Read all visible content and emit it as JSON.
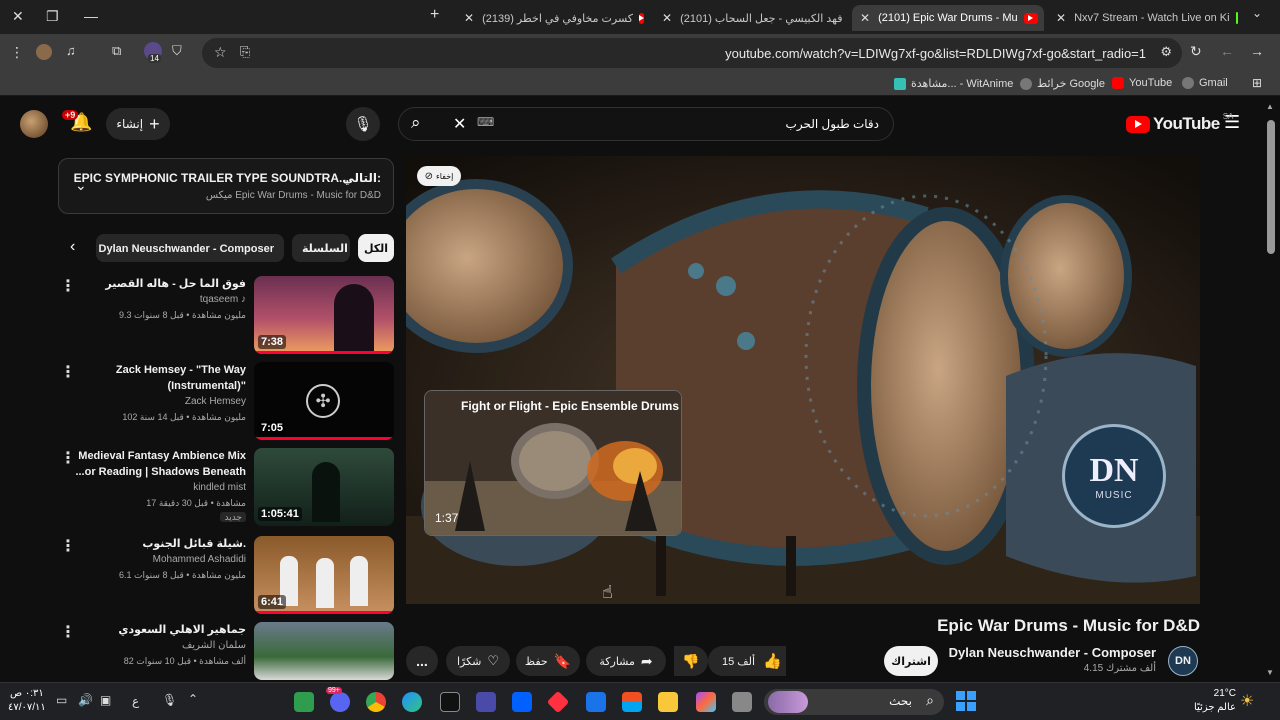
{
  "browser": {
    "tabs": [
      {
        "label": "Nxv7 Stream - Watch Live on Ki",
        "active": false
      },
      {
        "label": "(2101) Epic War Drums - Mu",
        "active": true
      },
      {
        "label": "(2101) فهد الكبيسي - جعل السحاب",
        "active": false
      },
      {
        "label": "(2139) كسرت مخاوفي في اخطر",
        "active": false
      }
    ],
    "url": "youtube.com/watch?v=LDIWg7xf-go&list=RDLDIWg7xf-go&start_radio=1",
    "extension_badge": "14",
    "bookmarks": [
      "Gmail",
      "YouTube",
      "خرائط Google",
      "مشاهدة... - WitAnime"
    ]
  },
  "youtube": {
    "logo_text": "YouTube",
    "region": "SA",
    "search_query": "دقات طبول الحرب",
    "create_label": "إنشاء",
    "notif_count": "+9"
  },
  "player": {
    "hide_label": "إخفاء",
    "brand_text": "DN",
    "brand_sub": "MUSIC",
    "preview_title": "Fight or Flight - Epic Ensemble Drums",
    "preview_duration": "1:37"
  },
  "video": {
    "title": "Epic War Drums - Music for D&D",
    "channel": "Dylan Neuschwander - Composer",
    "subscribers": "4.15 ألف مشترك",
    "avatar_text": "DN",
    "subscribe_label": "اشتراك",
    "likes": "15 ألف",
    "share_label": "مشاركة",
    "save_label": "حفظ",
    "thanks_label": "شكرًا",
    "more_label": "..."
  },
  "sidebar": {
    "next_label": "التالي:",
    "next_title": "EPIC SYMPHONIC TRAILER TYPE SOUNDTRA...",
    "next_sub": "ميكس Epic War Drums - Music for D&D",
    "chips": [
      "الكل",
      "من السلسلة",
      "من Dylan Neuschwander - Composer"
    ],
    "items": [
      {
        "title": "فوق الما حل - هاله القصير",
        "channel": "tqaseem ♪",
        "meta": "9.3 مليون مشاهدة • قبل 8 سنوات",
        "duration": "7:38",
        "badge": ""
      },
      {
        "title": "Zack Hemsey - \"The Way (Instrumental)\"",
        "channel": "Zack Hemsey",
        "meta": "102 مليون مشاهدة • قبل 14 سنة",
        "duration": "7:05",
        "badge": ""
      },
      {
        "title": "Medieval Fantasy Ambience Mix ...or Reading | Shadows Beneath",
        "channel": "kindled mist",
        "meta": "17 مشاهدة • قبل 30 دقيقة",
        "duration": "1:05:41",
        "badge": "جديد"
      },
      {
        "title": "شيلة قبائل الجنوب.",
        "channel": "Mohammed Ashadidi",
        "meta": "6.1 مليون مشاهدة • قبل 8 سنوات",
        "duration": "6:41",
        "badge": ""
      },
      {
        "title": "جماهير الاهلي السعودي",
        "channel": "سلمان الشريف",
        "meta": "82 ألف مشاهدة • قبل 10 سنوات",
        "duration": "",
        "badge": ""
      }
    ]
  },
  "taskbar": {
    "search_label": "بحث",
    "weather_temp": "21°C",
    "weather_text": "عالم جزئيًا",
    "time": "٠:٣١ ص",
    "date": "٤٧/٠٧/١١",
    "lang": "ع",
    "discord_badge": "99+"
  }
}
